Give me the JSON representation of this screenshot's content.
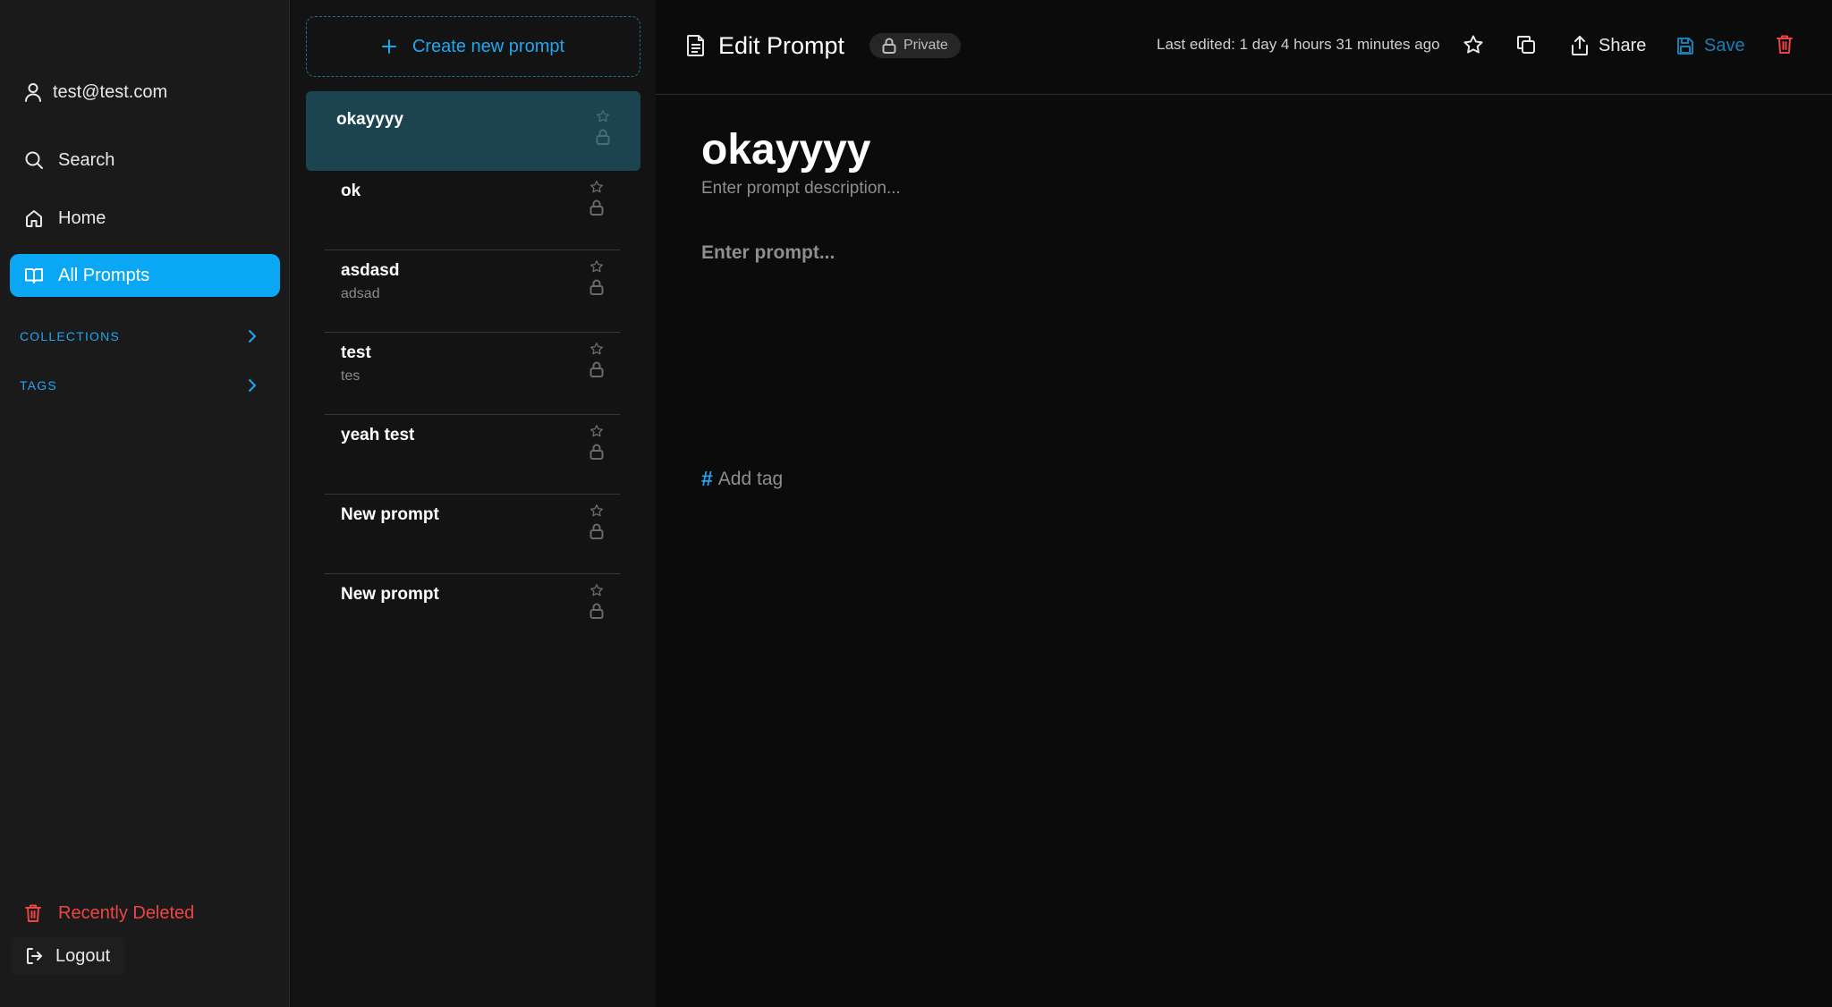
{
  "sidebar": {
    "user_email": "test@test.com",
    "nav": {
      "search": "Search",
      "home": "Home",
      "all_prompts": "All Prompts"
    },
    "sections": {
      "collections": "COLLECTIONS",
      "tags": "TAGS"
    },
    "recently_deleted": "Recently Deleted",
    "logout": "Logout"
  },
  "prompt_list": {
    "create_label": "Create new prompt",
    "items": [
      {
        "title": "okayyyy",
        "description": ""
      },
      {
        "title": "ok",
        "description": ""
      },
      {
        "title": "asdasd",
        "description": "adsad"
      },
      {
        "title": "test",
        "description": "tes"
      },
      {
        "title": "yeah test",
        "description": ""
      },
      {
        "title": "New prompt",
        "description": ""
      },
      {
        "title": "New prompt",
        "description": ""
      }
    ]
  },
  "editor": {
    "header": {
      "title": "Edit Prompt",
      "visibility": "Private",
      "last_edited": "Last edited: 1 day 4 hours 31 minutes ago",
      "share_label": "Share",
      "save_label": "Save"
    },
    "prompt_title": "okayyyy",
    "description_placeholder": "Enter prompt description...",
    "prompt_placeholder": "Enter prompt...",
    "add_tag_label": "Add tag"
  },
  "colors": {
    "accent": "#0aa7f5",
    "danger": "#ef4444",
    "selected_item": "#1b4350"
  }
}
